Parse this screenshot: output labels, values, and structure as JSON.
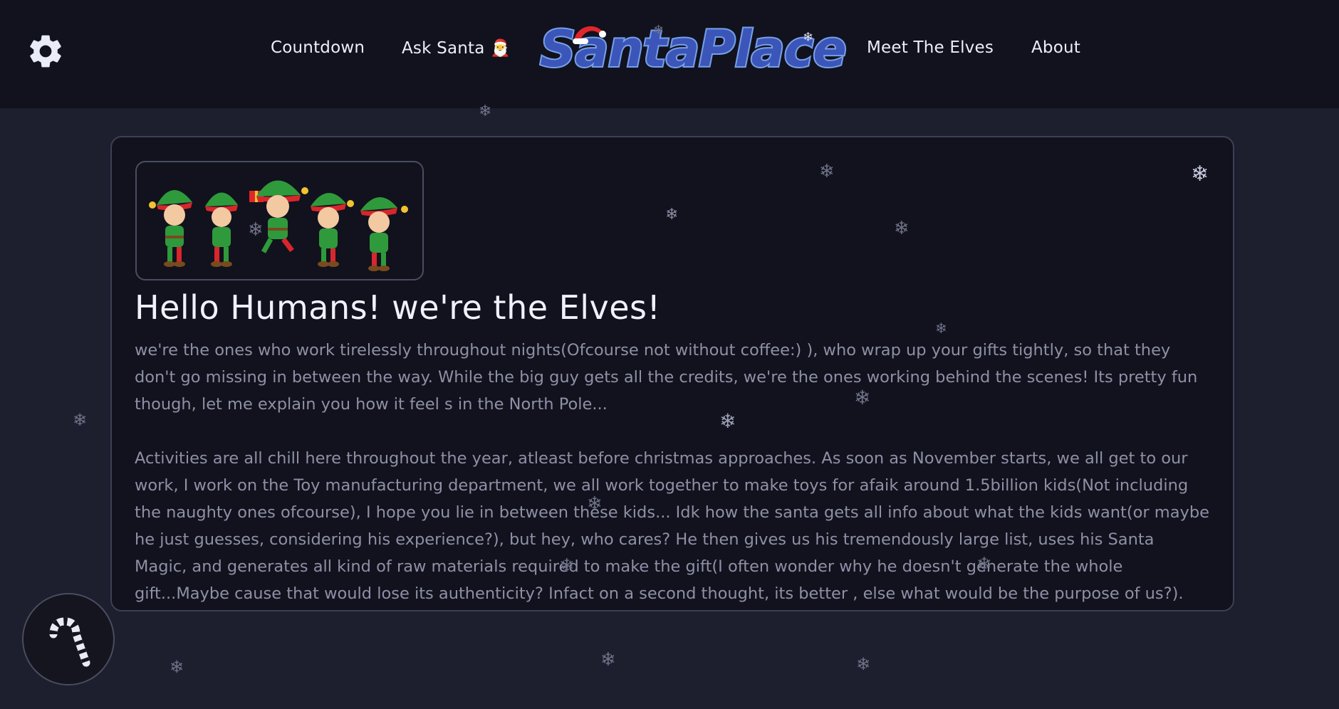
{
  "navbar": {
    "settings_icon": "gear-icon",
    "links": [
      {
        "label": "Countdown"
      },
      {
        "label": "Ask Santa 🎅"
      },
      {
        "label": "Meet The Elves"
      },
      {
        "label": "About"
      }
    ],
    "logo_text": "SantaPlace"
  },
  "content": {
    "image_icon": "elves-illustration",
    "heading": "Hello Humans! we're the Elves!",
    "paragraph1": "we're the ones who work tirelessly throughout nights(Ofcourse not without coffee:) ), who wrap up your gifts tightly, so that they don't go missing in between the way. While the big guy gets all the credits, we're the ones working behind the scenes! Its pretty fun though, let me explain you how it feel s in the North Pole...",
    "paragraph2": "Activities are all chill here throughout the year, atleast before christmas approaches. As soon as November starts, we all get to our work, I work on the Toy manufacturing department, we all work together to make toys for afaik around 1.5billion kids(Not including the naughty ones ofcourse), I hope you lie in between these kids... Idk how the santa gets all info about what the kids want(or maybe he just guesses, considering his experience?), but hey, who cares? He then gives us his tremendously large list, uses his Santa Magic, and generates all kind of raw materials required to make the gift(I often wonder why he doesn't generate the whole gift...Maybe cause that would lose its authenticity? Infact on a second thought, its better , else what would be the purpose of us?)."
  },
  "floating_button": {
    "icon": "candy-cane-icon"
  },
  "decor": {
    "snowflake_glyph": "❄",
    "snowflake_icon": "snowflake-icon"
  },
  "colors": {
    "background": "#1d1e2e",
    "navbar": "#11121d",
    "card": "#11121d",
    "heading": "#f0f1fb",
    "body_text": "#8e90a6",
    "logo_fill": "#3c55b8",
    "logo_outline": "#6f9ae6"
  }
}
